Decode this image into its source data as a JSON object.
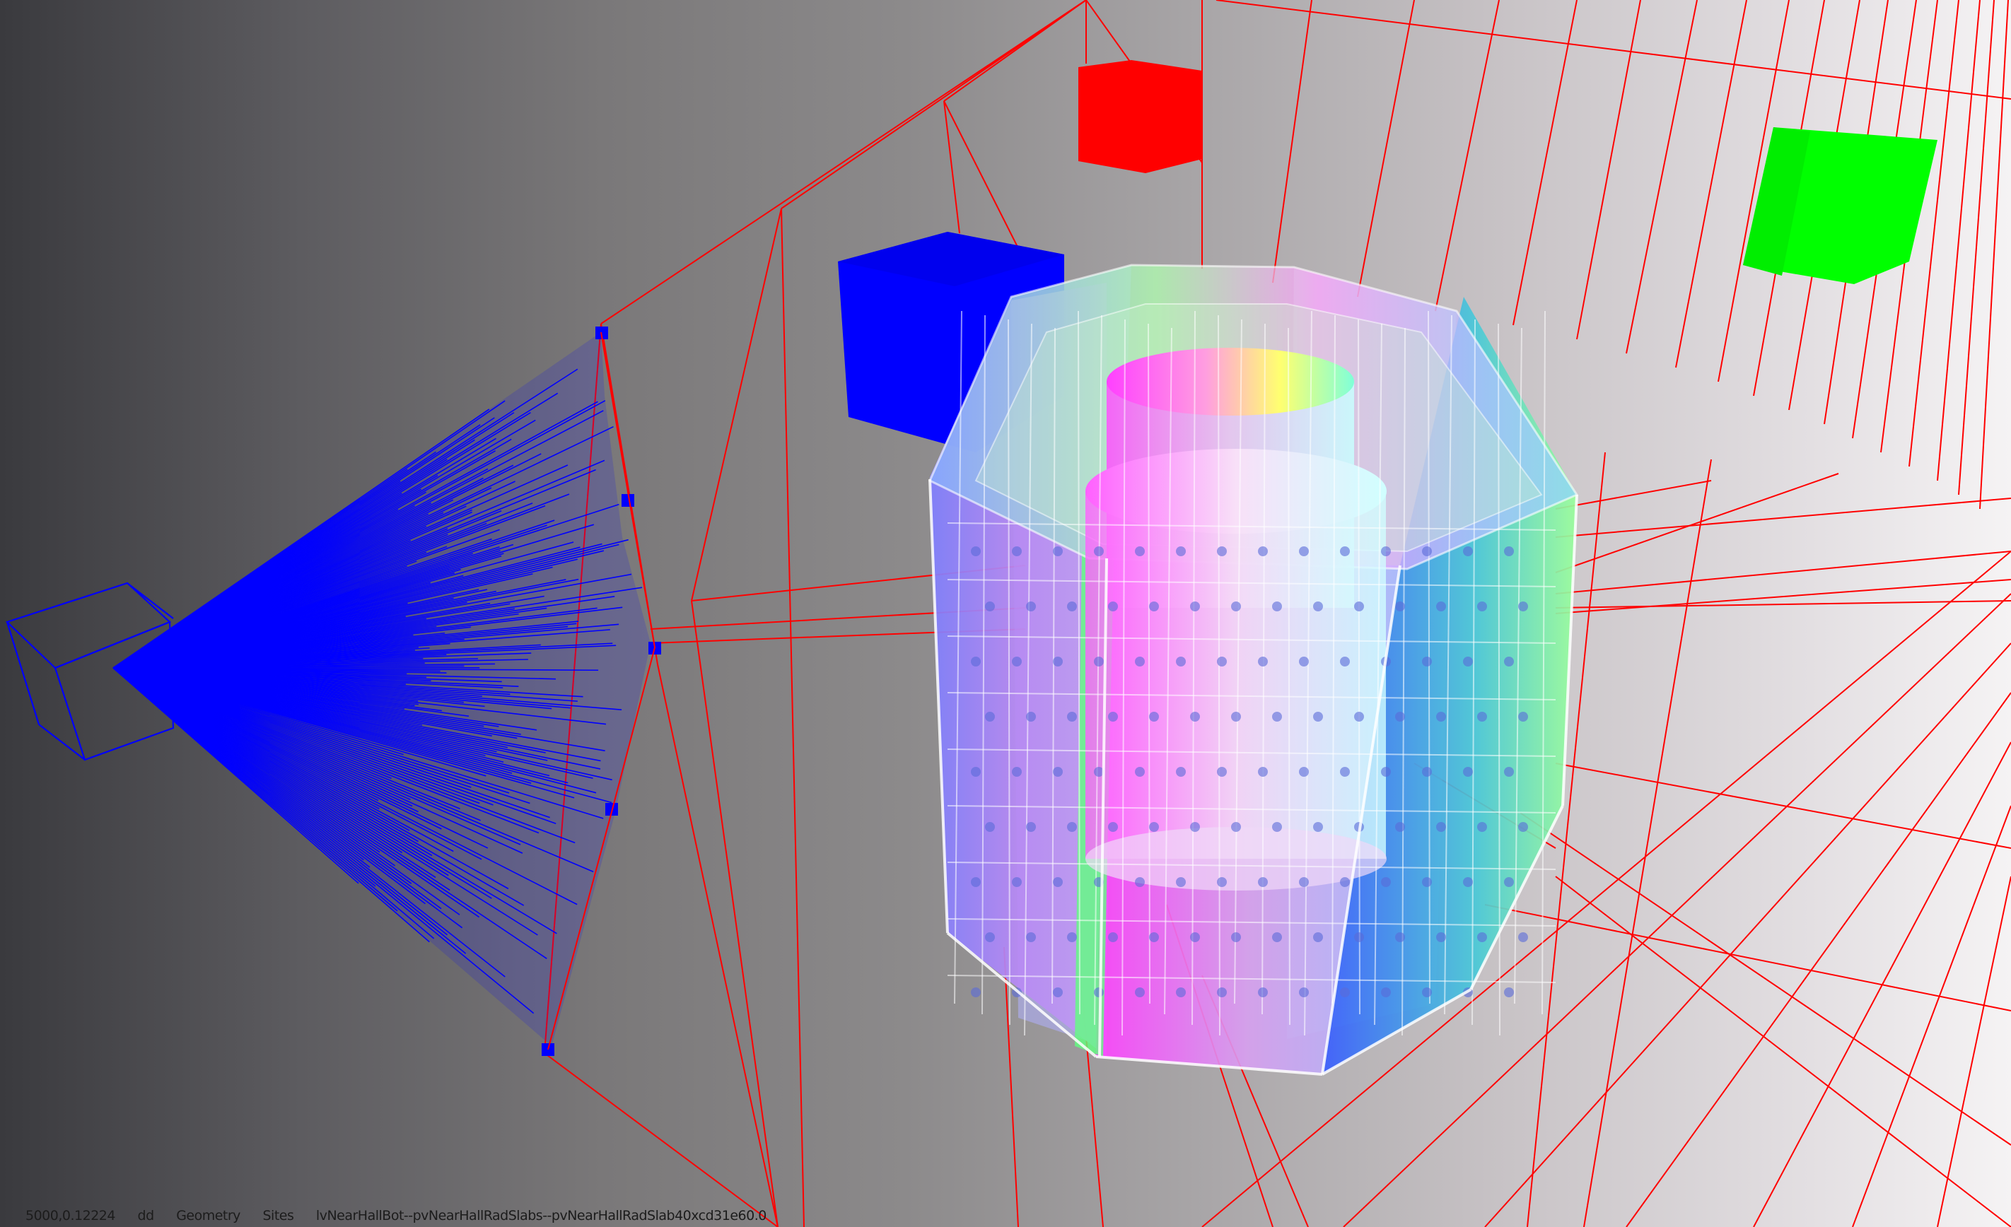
{
  "status_bar": {
    "coords": "5000,0.12224",
    "item_dd": "dd",
    "item_geometry": "Geometry",
    "item_sites": "Sites",
    "volume_path": "lvNearHallBot--pvNearHallRadSlabs--pvNearHallRadSlab40xcd31e60.0"
  },
  "colors": {
    "grid_lines": "#ff0000",
    "camera_frustum": "#0000ff",
    "axis_cube_x": "#ff0000",
    "axis_cube_y": "#00ff00",
    "axis_cube_z": "#0000ff"
  }
}
